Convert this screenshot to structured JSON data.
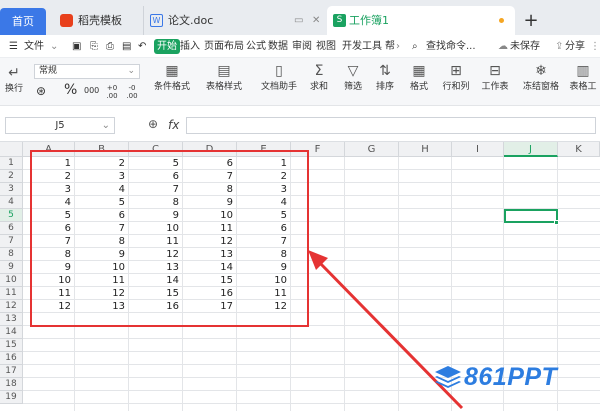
{
  "tabs": {
    "home": "首页",
    "template": "稻壳模板",
    "doc": "论文.doc",
    "workbook": "工作簿1",
    "add": "+"
  },
  "menu": {
    "file": "文件",
    "start": "开始",
    "insert": "插入",
    "page_layout": "页面布局",
    "formula": "公式",
    "data": "数据",
    "review": "审阅",
    "view": "视图",
    "dev_tools": "开发工具",
    "more": "帮",
    "search": "查找命令...",
    "saving": "未保存",
    "share": "分享"
  },
  "ribbon": {
    "number_format": "常规",
    "wrap": "换行",
    "percent": "%",
    "thousands": "000",
    "dec_inc": "+0 .00",
    "dec_dec": "-0 .00",
    "conditional_format": "条件格式",
    "table_style": "表格样式",
    "doc_helper": "文档助手",
    "sum": "求和",
    "filter": "筛选",
    "sort": "排序",
    "format": "格式",
    "rows_cols": "行和列",
    "worksheet": "工作表",
    "freeze": "冻结窗格",
    "table_tools": "表格工"
  },
  "formula_bar": {
    "name_box": "J5",
    "fx": "fx",
    "value": ""
  },
  "sheet": {
    "columns": [
      "A",
      "B",
      "C",
      "D",
      "E",
      "F",
      "G",
      "H",
      "I",
      "J",
      "K"
    ],
    "selected_column": "J",
    "rows": [
      "1",
      "2",
      "3",
      "4",
      "5",
      "6",
      "7",
      "8",
      "9",
      "10",
      "11",
      "12",
      "13",
      "14",
      "15",
      "16",
      "17",
      "18",
      "19"
    ],
    "selected_row": "5",
    "data": [
      [
        "1",
        "2",
        "5",
        "6",
        "1"
      ],
      [
        "2",
        "3",
        "6",
        "7",
        "2"
      ],
      [
        "3",
        "4",
        "7",
        "8",
        "3"
      ],
      [
        "4",
        "5",
        "8",
        "9",
        "4"
      ],
      [
        "5",
        "6",
        "9",
        "10",
        "5"
      ],
      [
        "6",
        "7",
        "10",
        "11",
        "6"
      ],
      [
        "7",
        "8",
        "11",
        "12",
        "7"
      ],
      [
        "8",
        "9",
        "12",
        "13",
        "8"
      ],
      [
        "9",
        "10",
        "13",
        "14",
        "9"
      ],
      [
        "10",
        "11",
        "14",
        "15",
        "10"
      ],
      [
        "11",
        "12",
        "15",
        "16",
        "11"
      ],
      [
        "12",
        "13",
        "16",
        "17",
        "12"
      ]
    ]
  },
  "watermark": "861PPT",
  "colors": {
    "accent_green": "#1aa260",
    "home_blue": "#3b78e7",
    "annotation_red": "#e53333",
    "watermark_blue": "#2d7de0"
  }
}
